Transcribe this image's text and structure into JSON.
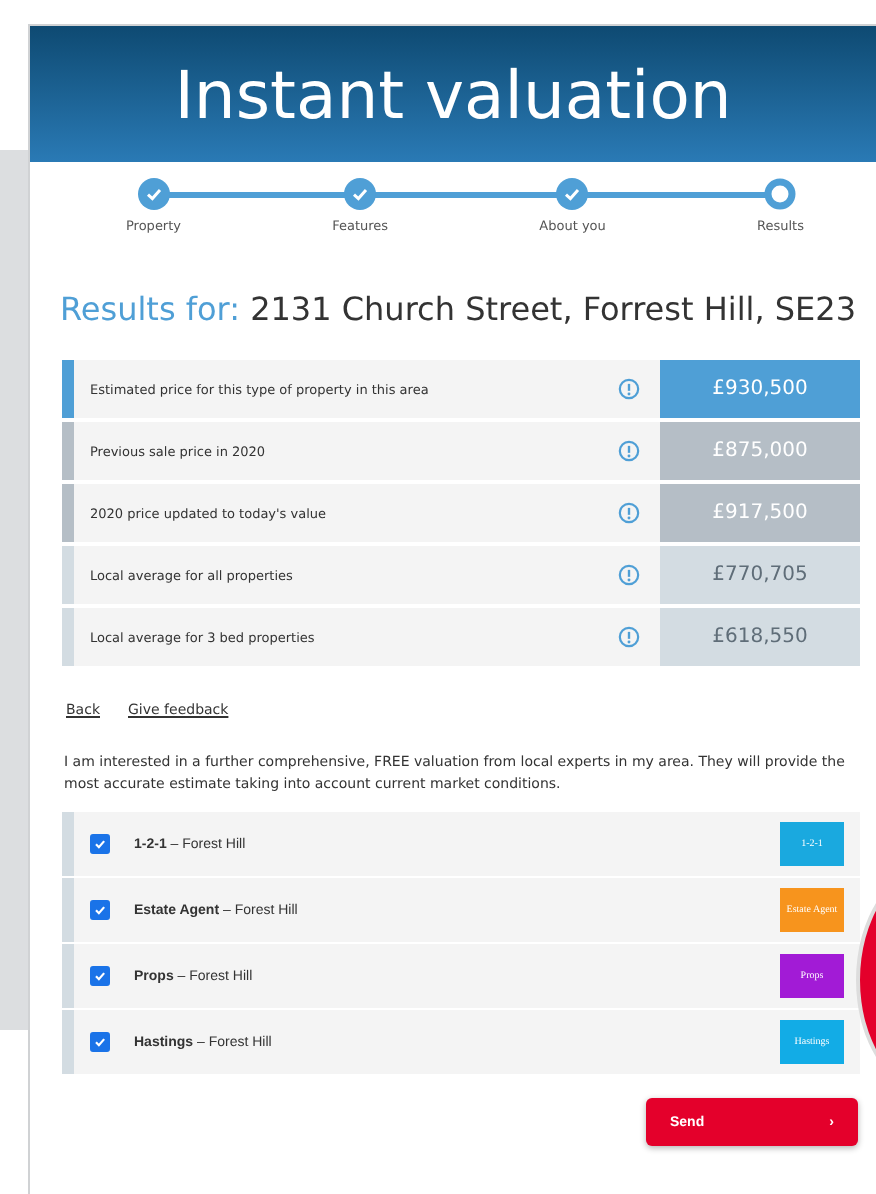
{
  "header": {
    "title": "Instant valuation"
  },
  "steps": [
    {
      "label": "Property",
      "completed": true
    },
    {
      "label": "Features",
      "completed": true
    },
    {
      "label": "About you",
      "completed": true
    },
    {
      "label": "Results",
      "completed": false
    }
  ],
  "results": {
    "prefix": "Results for:",
    "address": "2131 Church Street, Forrest Hill, SE23"
  },
  "prices": [
    {
      "label": "Estimated price for this type of property in this area",
      "value": "£930,500",
      "color": "#4f9fd6"
    },
    {
      "label": "Previous sale price in 2020",
      "value": "£875,000",
      "color": "#b5bec6"
    },
    {
      "label": "2020 price updated to today's value",
      "value": "£917,500",
      "color": "#b5bec6"
    },
    {
      "label": "Local average for all properties",
      "value": "£770,705",
      "color": "#d3dce2"
    },
    {
      "label": "Local average for 3 bed properties",
      "value": "£618,550",
      "color": "#d3dce2"
    }
  ],
  "links": [
    "Back",
    "Give feedback"
  ],
  "intro": "I am interested in a further comprehensive, FREE valuation from local experts in my area. They will provide the most accurate estimate taking into account current market conditions.",
  "agents": [
    {
      "name": "1-2-1",
      "area": "– Forest Hill",
      "checked": true,
      "logo_text": "1-2-1",
      "color": "#1aa9df"
    },
    {
      "name": "Estate Agent",
      "area": "– Forest Hill",
      "checked": true,
      "logo_text": "Estate Agent",
      "color": "#f7941d"
    },
    {
      "name": "Props",
      "area": "– Forest Hill",
      "checked": true,
      "logo_text": "Props",
      "color": "#a21bd6"
    },
    {
      "name": "Hastings",
      "area": "– Forest Hill",
      "checked": true,
      "logo_text": "Hastings",
      "color": "#12ace6"
    }
  ],
  "send_button": {
    "label": "Send",
    "arrow": "›"
  }
}
